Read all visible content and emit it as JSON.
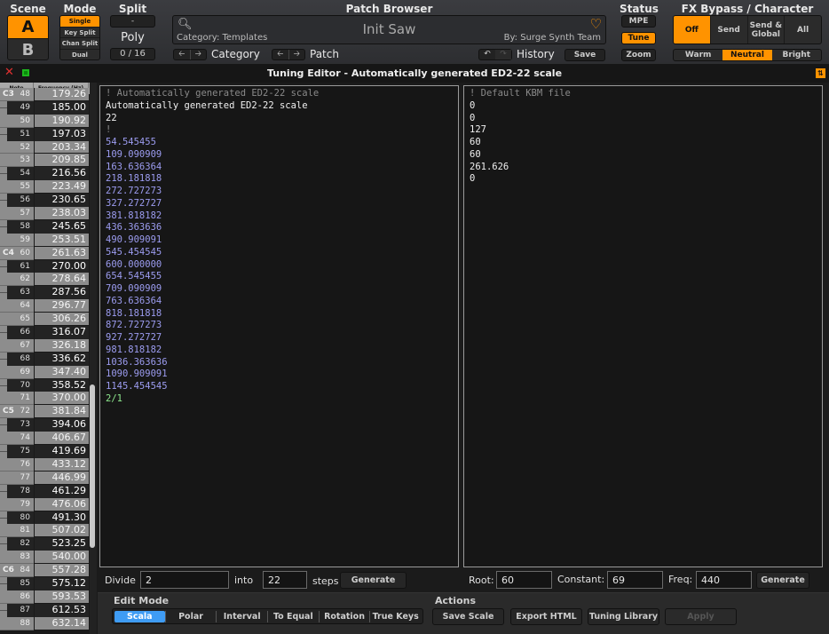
{
  "header": {
    "scene": {
      "title": "Scene",
      "options": [
        "A",
        "B"
      ],
      "selected": "A"
    },
    "mode": {
      "title": "Mode",
      "options": [
        "Single",
        "Key Split",
        "Chan Split",
        "Dual"
      ],
      "selected": "Single"
    },
    "split": {
      "title": "Split",
      "value": "-"
    },
    "poly": {
      "title": "Poly",
      "value": "0 / 16"
    },
    "patch_browser": {
      "title": "Patch Browser",
      "category": "Category: Templates",
      "patch_name": "Init Saw",
      "author": "By: Surge Synth Team",
      "category_nav_label": "Category",
      "patch_nav_label": "Patch",
      "history_label": "History",
      "save_label": "Save",
      "search_icon": "search-icon",
      "favorite_icon": "heart-icon"
    },
    "status": {
      "title": "Status",
      "mpe": "MPE",
      "tune": "Tune",
      "zoom": "Zoom",
      "tune_active": true
    },
    "fx": {
      "title": "FX Bypass / Character",
      "bypass_options": [
        "Off",
        "Send",
        "Send & Global",
        "All"
      ],
      "bypass_selected": "Off",
      "character_options": [
        "Warm",
        "Neutral",
        "Bright"
      ],
      "character_selected": "Neutral"
    }
  },
  "tuning_editor": {
    "title": "Tuning Editor - Automatically generated ED2-22 scale",
    "table": {
      "headers": {
        "note": "Note",
        "freq": "Frequency (Hz)"
      },
      "rows": [
        {
          "note": "48",
          "freq": "179.26",
          "black": false,
          "c_label": "C3"
        },
        {
          "note": "49",
          "freq": "185.00",
          "black": true
        },
        {
          "note": "50",
          "freq": "190.92",
          "black": false
        },
        {
          "note": "51",
          "freq": "197.03",
          "black": true
        },
        {
          "note": "52",
          "freq": "203.34",
          "black": false
        },
        {
          "note": "53",
          "freq": "209.85",
          "black": false
        },
        {
          "note": "54",
          "freq": "216.56",
          "black": true
        },
        {
          "note": "55",
          "freq": "223.49",
          "black": false
        },
        {
          "note": "56",
          "freq": "230.65",
          "black": true
        },
        {
          "note": "57",
          "freq": "238.03",
          "black": false
        },
        {
          "note": "58",
          "freq": "245.65",
          "black": true
        },
        {
          "note": "59",
          "freq": "253.51",
          "black": false
        },
        {
          "note": "60",
          "freq": "261.63",
          "black": false,
          "c_label": "C4"
        },
        {
          "note": "61",
          "freq": "270.00",
          "black": true
        },
        {
          "note": "62",
          "freq": "278.64",
          "black": false
        },
        {
          "note": "63",
          "freq": "287.56",
          "black": true
        },
        {
          "note": "64",
          "freq": "296.77",
          "black": false
        },
        {
          "note": "65",
          "freq": "306.26",
          "black": false
        },
        {
          "note": "66",
          "freq": "316.07",
          "black": true
        },
        {
          "note": "67",
          "freq": "326.18",
          "black": false
        },
        {
          "note": "68",
          "freq": "336.62",
          "black": true
        },
        {
          "note": "69",
          "freq": "347.40",
          "black": false
        },
        {
          "note": "70",
          "freq": "358.52",
          "black": true
        },
        {
          "note": "71",
          "freq": "370.00",
          "black": false
        },
        {
          "note": "72",
          "freq": "381.84",
          "black": false,
          "c_label": "C5"
        },
        {
          "note": "73",
          "freq": "394.06",
          "black": true
        },
        {
          "note": "74",
          "freq": "406.67",
          "black": false
        },
        {
          "note": "75",
          "freq": "419.69",
          "black": true
        },
        {
          "note": "76",
          "freq": "433.12",
          "black": false
        },
        {
          "note": "77",
          "freq": "446.99",
          "black": false
        },
        {
          "note": "78",
          "freq": "461.29",
          "black": true
        },
        {
          "note": "79",
          "freq": "476.06",
          "black": false
        },
        {
          "note": "80",
          "freq": "491.30",
          "black": true
        },
        {
          "note": "81",
          "freq": "507.02",
          "black": false
        },
        {
          "note": "82",
          "freq": "523.25",
          "black": true
        },
        {
          "note": "83",
          "freq": "540.00",
          "black": false
        },
        {
          "note": "84",
          "freq": "557.28",
          "black": false,
          "c_label": "C6"
        },
        {
          "note": "85",
          "freq": "575.12",
          "black": true
        },
        {
          "note": "86",
          "freq": "593.53",
          "black": false
        },
        {
          "note": "87",
          "freq": "612.53",
          "black": true
        },
        {
          "note": "88",
          "freq": "632.14",
          "black": false
        }
      ]
    },
    "scl_lines": [
      {
        "text": "! Automatically generated ED2-22 scale",
        "kind": "comment"
      },
      {
        "text": "Automatically generated ED2-22 scale",
        "kind": "text"
      },
      {
        "text": "22",
        "kind": "text"
      },
      {
        "text": "!",
        "kind": "comment"
      },
      {
        "text": "54.545455",
        "kind": "cents"
      },
      {
        "text": "109.090909",
        "kind": "cents"
      },
      {
        "text": "163.636364",
        "kind": "cents"
      },
      {
        "text": "218.181818",
        "kind": "cents"
      },
      {
        "text": "272.727273",
        "kind": "cents"
      },
      {
        "text": "327.272727",
        "kind": "cents"
      },
      {
        "text": "381.818182",
        "kind": "cents"
      },
      {
        "text": "436.363636",
        "kind": "cents"
      },
      {
        "text": "490.909091",
        "kind": "cents"
      },
      {
        "text": "545.454545",
        "kind": "cents"
      },
      {
        "text": "600.000000",
        "kind": "cents"
      },
      {
        "text": "654.545455",
        "kind": "cents"
      },
      {
        "text": "709.090909",
        "kind": "cents"
      },
      {
        "text": "763.636364",
        "kind": "cents"
      },
      {
        "text": "818.181818",
        "kind": "cents"
      },
      {
        "text": "872.727273",
        "kind": "cents"
      },
      {
        "text": "927.272727",
        "kind": "cents"
      },
      {
        "text": "981.818182",
        "kind": "cents"
      },
      {
        "text": "1036.363636",
        "kind": "cents"
      },
      {
        "text": "1090.909091",
        "kind": "cents"
      },
      {
        "text": "1145.454545",
        "kind": "cents"
      },
      {
        "text": "2/1",
        "kind": "ratio"
      }
    ],
    "kbm_lines": [
      {
        "text": "! Default KBM file",
        "kind": "comment"
      },
      {
        "text": "0",
        "kind": "text"
      },
      {
        "text": "0",
        "kind": "text"
      },
      {
        "text": "127",
        "kind": "text"
      },
      {
        "text": "60",
        "kind": "text"
      },
      {
        "text": "60",
        "kind": "text"
      },
      {
        "text": "261.626",
        "kind": "text"
      },
      {
        "text": "0",
        "kind": "text"
      }
    ],
    "scl_generator": {
      "divide_label": "Divide",
      "divide_value": "2",
      "into_label": "into",
      "steps_value": "22",
      "steps_label": "steps",
      "generate_label": "Generate"
    },
    "kbm_generator": {
      "root_label": "Root:",
      "root_value": "60",
      "constant_label": "Constant:",
      "constant_value": "69",
      "freq_label": "Freq:",
      "freq_value": "440",
      "generate_label": "Generate"
    },
    "edit_mode": {
      "label": "Edit Mode",
      "options": [
        "Scala",
        "Polar",
        "Interval",
        "To Equal",
        "Rotation",
        "True Keys"
      ],
      "selected": "Scala"
    },
    "actions": {
      "label": "Actions",
      "save_scale": "Save Scale",
      "export_html": "Export HTML",
      "tuning_library": "Tuning Library",
      "apply": "Apply"
    }
  },
  "colors": {
    "accent": "#ff9300",
    "selected_mode": "#3f9cf4",
    "cents": "#9c9cf0",
    "ratio": "#8ee88e",
    "comment": "#8a8a8a"
  }
}
